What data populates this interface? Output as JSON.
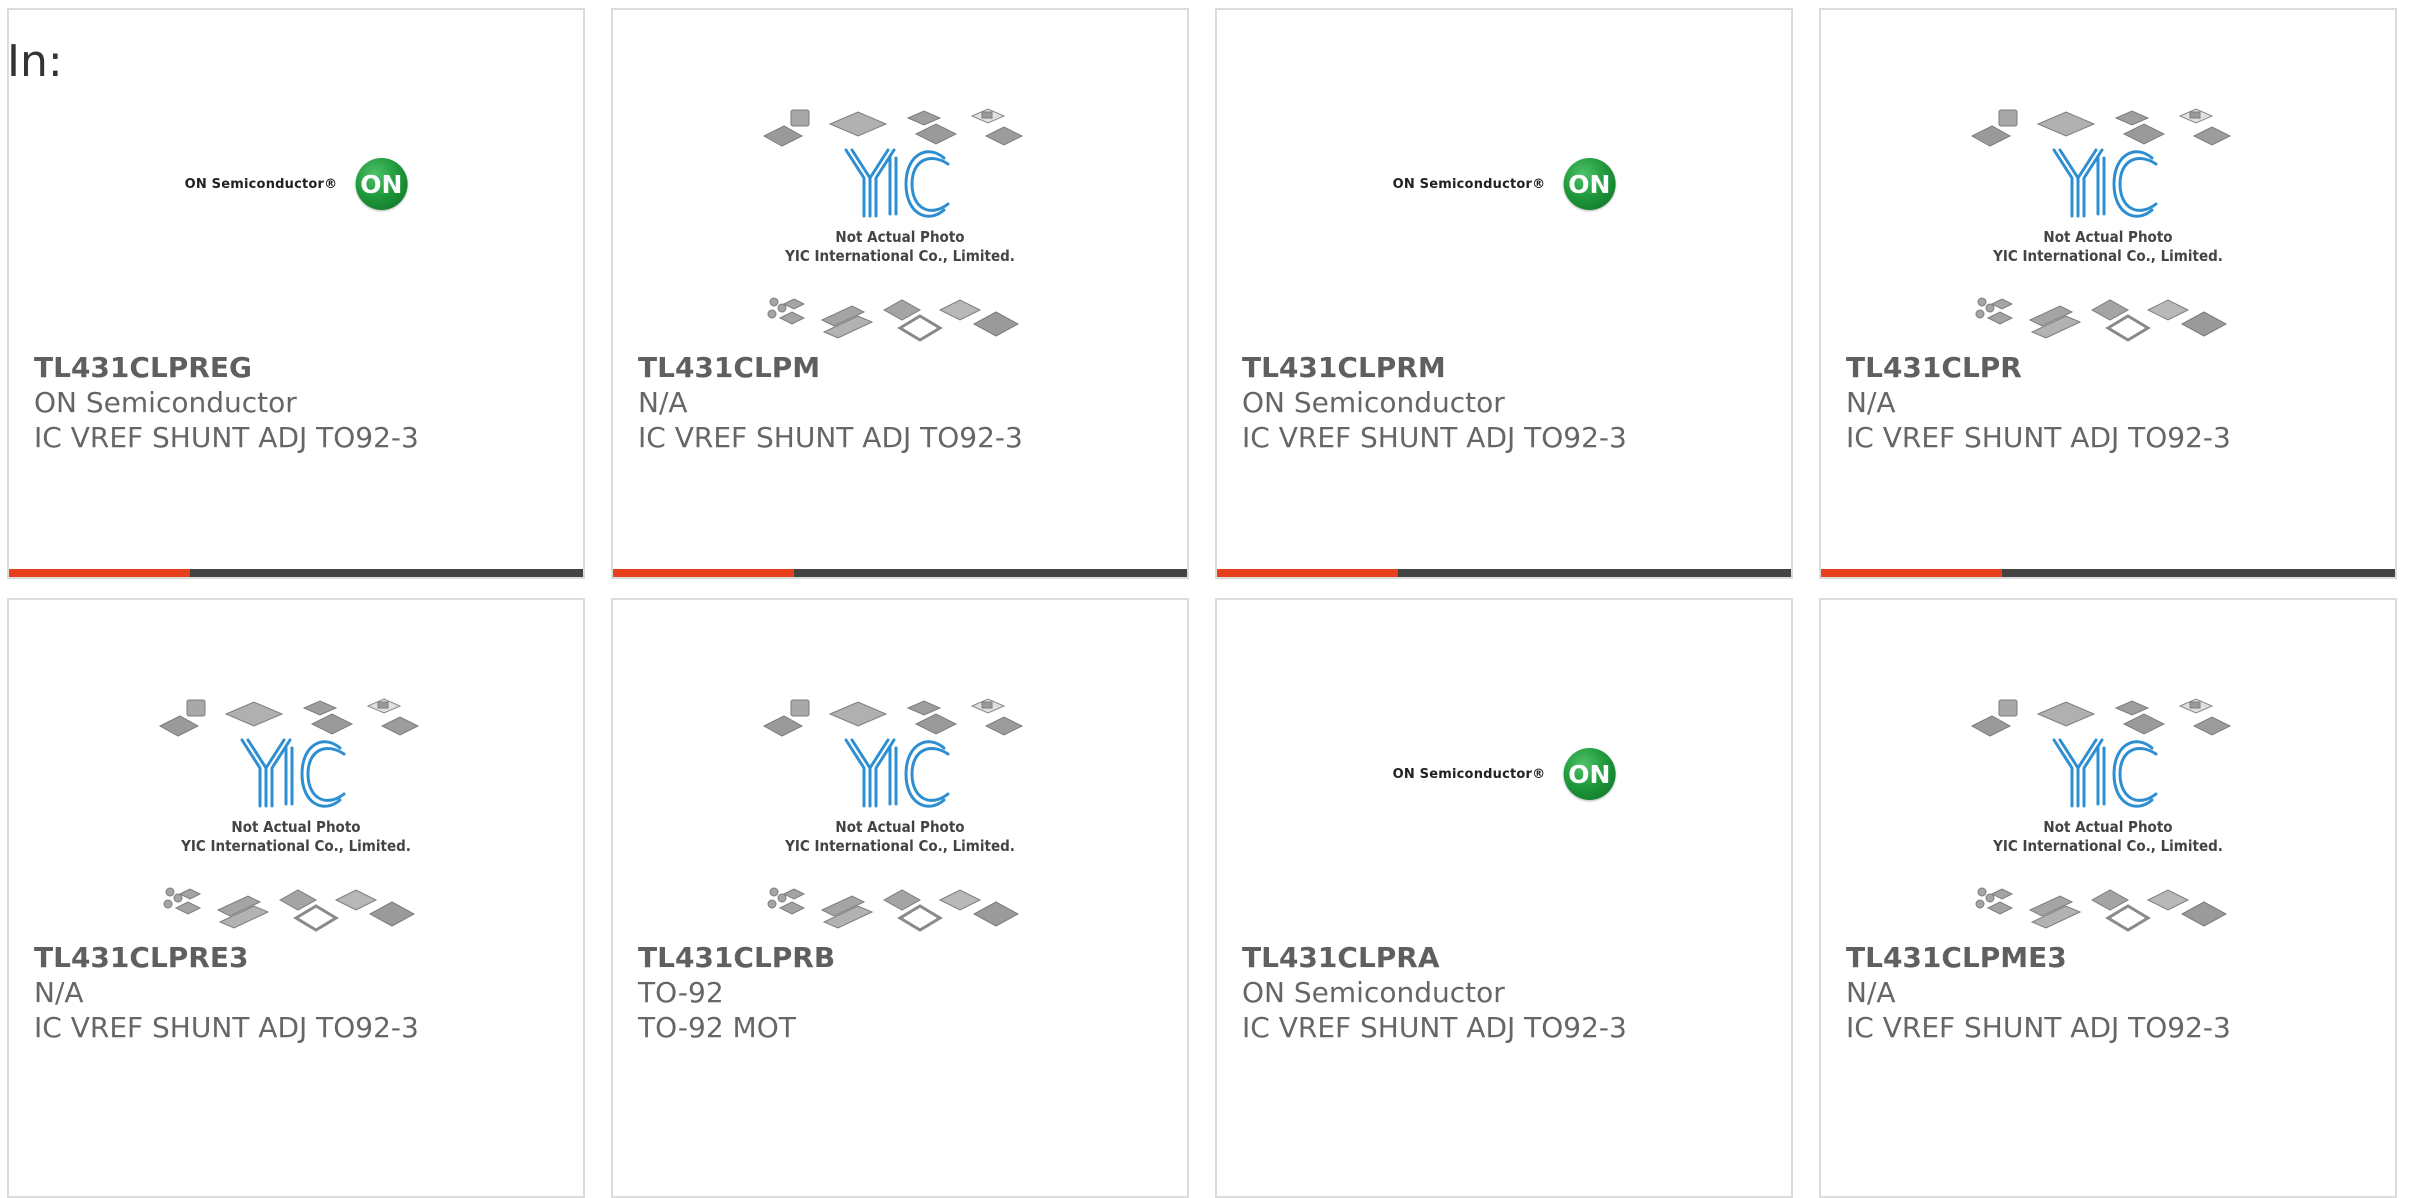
{
  "header": {
    "prefix_label": "In:"
  },
  "colors": {
    "accent_bar": "#e8401c",
    "bar_base": "#444444",
    "card_border": "#dcdcdc",
    "text": "#666666"
  },
  "placeholder": {
    "line1": "Not Actual Photo",
    "line2": "YIC International Co., Limited.",
    "logo_text": "YIC"
  },
  "on_logo": {
    "text": "ON Semiconductor®",
    "badge": "ON"
  },
  "products": [
    {
      "part_number": "TL431CLPREG",
      "manufacturer": "ON Semiconductor",
      "description": "IC VREF SHUNT ADJ TO92-3",
      "image": "on-semiconductor-logo"
    },
    {
      "part_number": "TL431CLPM",
      "manufacturer": "N/A",
      "description": "IC VREF SHUNT ADJ TO92-3",
      "image": "yic-placeholder"
    },
    {
      "part_number": "TL431CLPRM",
      "manufacturer": "ON Semiconductor",
      "description": "IC VREF SHUNT ADJ TO92-3",
      "image": "on-semiconductor-logo"
    },
    {
      "part_number": "TL431CLPR",
      "manufacturer": "N/A",
      "description": "IC VREF SHUNT ADJ TO92-3",
      "image": "yic-placeholder"
    },
    {
      "part_number": "TL431CLPRE3",
      "manufacturer": "N/A",
      "description": "IC VREF SHUNT ADJ TO92-3",
      "image": "yic-placeholder"
    },
    {
      "part_number": "TL431CLPRB",
      "manufacturer": "TO-92",
      "description": "TO-92 MOT",
      "image": "yic-placeholder"
    },
    {
      "part_number": "TL431CLPRA",
      "manufacturer": "ON Semiconductor",
      "description": "IC VREF SHUNT ADJ TO92-3",
      "image": "on-semiconductor-logo"
    },
    {
      "part_number": "TL431CLPME3",
      "manufacturer": "N/A",
      "description": "IC VREF SHUNT ADJ TO92-3",
      "image": "yic-placeholder"
    }
  ]
}
